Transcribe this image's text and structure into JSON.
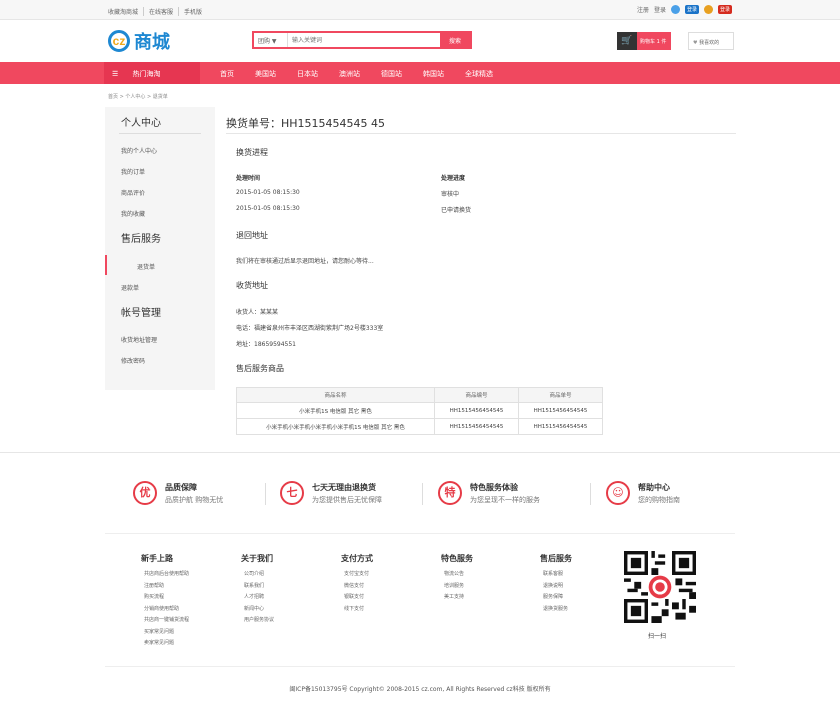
{
  "topbar": {
    "links": [
      "收藏淘商城",
      "在线客服",
      "手机版"
    ],
    "register": "注册",
    "login": "登录",
    "qq_label": "登录",
    "weibo_label": "登录"
  },
  "header": {
    "logo_mark": "cz",
    "logo_name": "商城",
    "search_category": "团购 ▼",
    "search_placeholder": "输入关键词",
    "search_button": "搜索",
    "cart_label": "购物车 1 件",
    "favorites_label": "我喜欢的"
  },
  "nav": {
    "category": "热门海淘",
    "items": [
      "首页",
      "美国站",
      "日本站",
      "澳洲站",
      "德国站",
      "韩国站",
      "全球精选"
    ]
  },
  "breadcrumb": "首页 > 个人中心 > 退货单",
  "sidebar": {
    "personal_heading": "个人中心",
    "personal_items": [
      "我的个人中心",
      "我的订单",
      "商品评价",
      "我的收藏"
    ],
    "aftersale_heading": "售后服务",
    "aftersale_items": [
      "退货单",
      "退款单"
    ],
    "account_heading": "帐号管理",
    "account_items": [
      "收货地址管理",
      "修改密码"
    ]
  },
  "main": {
    "title": "换货单号：HH1515454545 45",
    "progress_heading": "换货进程",
    "col_time": "处理时间",
    "col_status": "处理进度",
    "rows": [
      {
        "time": "2015-01-05 08:15:30",
        "status": "审核中"
      },
      {
        "time": "2015-01-05 08:15:30",
        "status": "已申请换货"
      }
    ],
    "return_heading": "退回地址",
    "return_text": "我们将在审核通过后显示退回地址，请您耐心等待...",
    "ship_heading": "收货地址",
    "receiver": "收货人：某某某",
    "phone_addr": "电话：福建省泉州市丰泽区西湖街紫荆广场2号楼333室",
    "address": "地址：18659594551",
    "goods_heading": "售后服务商品",
    "table_headers": [
      "商品名称",
      "商品编号",
      "商品单号"
    ],
    "table_rows": [
      [
        "小米手机1S 电信版 其它 黑色",
        "HH1515456454545",
        "HH1515456454545"
      ],
      [
        "小米手机小米手机小米手机小米手机1S 电信版 其它 黑色",
        "HH1515456454545",
        "HH1515456454545"
      ]
    ]
  },
  "footer": {
    "guarantees": [
      {
        "icon": "优",
        "title": "品质保障",
        "desc": "品质护航 购物无忧"
      },
      {
        "icon": "七",
        "title": "七天无理由退换货",
        "desc": "为您提供售后无忧保障"
      },
      {
        "icon": "特",
        "title": "特色服务体验",
        "desc": "为您呈现不一样的服务"
      },
      {
        "icon": "☺",
        "title": "帮助中心",
        "desc": "您的购物指南"
      }
    ],
    "columns": [
      {
        "title": "新手上路",
        "items": [
          "共店商后台使用帮助",
          "注册帮助",
          "购买流程",
          "分销商使用帮助",
          "共店商一键铺货流程",
          "买家常见问题",
          "卖家常见问题"
        ]
      },
      {
        "title": "关于我们",
        "items": [
          "公司介绍",
          "联系我们",
          "人才招聘",
          "新闻中心",
          "用户服务协议"
        ]
      },
      {
        "title": "支付方式",
        "items": [
          "支付宝支付",
          "微信支付",
          "银联支付",
          "线下支付"
        ]
      },
      {
        "title": "特色服务",
        "items": [
          "物流公告",
          "培训服务",
          "美工支持"
        ]
      },
      {
        "title": "售后服务",
        "items": [
          "联系客服",
          "退换说明",
          "服务保障",
          "退换货服务"
        ]
      }
    ],
    "qr_label": "扫一扫",
    "copyright": "闽ICP备15013795号 Copyright© 2008-2015 cz.com, All Rights Reserved cz科技 版权所有"
  },
  "colors": {
    "accent": "#f0485f",
    "brand_blue": "#1e88d2"
  }
}
